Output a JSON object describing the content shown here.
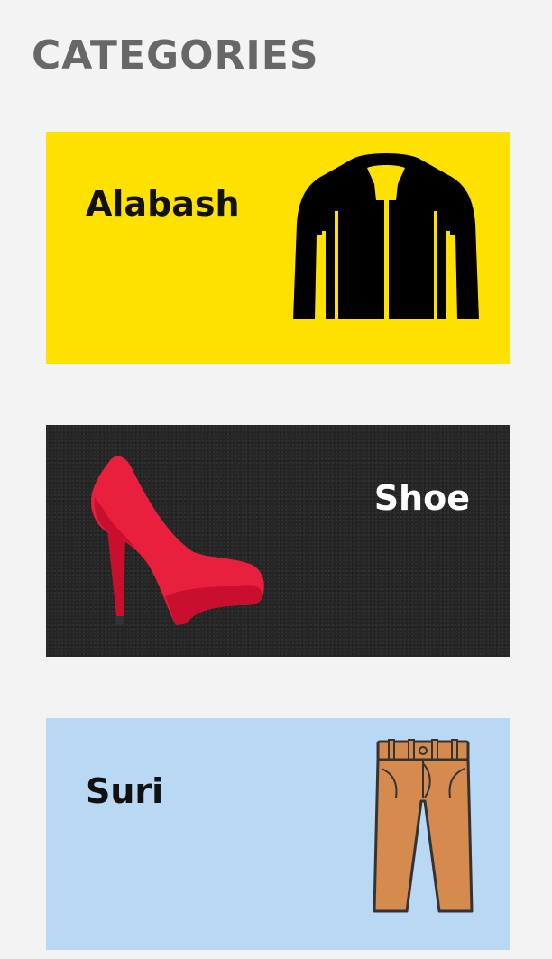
{
  "page": {
    "title": "CATEGORIES"
  },
  "categories": [
    {
      "label": "Alabash",
      "icon": "jacket-icon",
      "background": "#FFE100",
      "text_color": "#111111"
    },
    {
      "label": "Shoe",
      "icon": "high-heel-shoe-icon",
      "background": "#262626",
      "text_color": "#FFFFFF"
    },
    {
      "label": "Suri",
      "icon": "trousers-icon",
      "background": "#B9D8F4",
      "text_color": "#111111"
    }
  ],
  "colors": {
    "page_background": "#F3F3F3",
    "heading": "#676767",
    "shoe_red": "#E8203D",
    "trousers_tan": "#D58A4E"
  }
}
